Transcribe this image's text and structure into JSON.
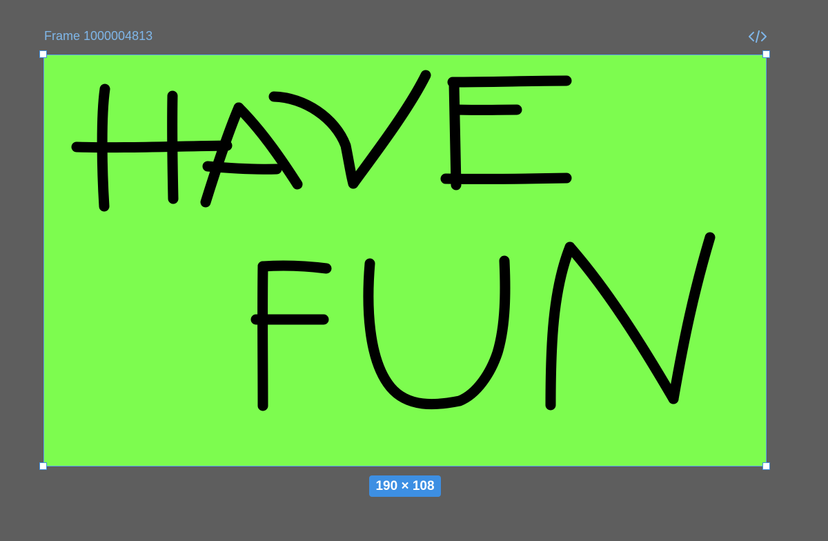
{
  "frame": {
    "name": "Frame 1000004813",
    "size_label": "190 × 108",
    "fill_color": "#7dfc4f",
    "selection_color": "#3d8fe3",
    "drawing_text": "HAVE FUN"
  },
  "toolbar": {
    "code_icon": "code-brackets-icon"
  },
  "canvas": {
    "background_color": "#5e5e5e"
  }
}
